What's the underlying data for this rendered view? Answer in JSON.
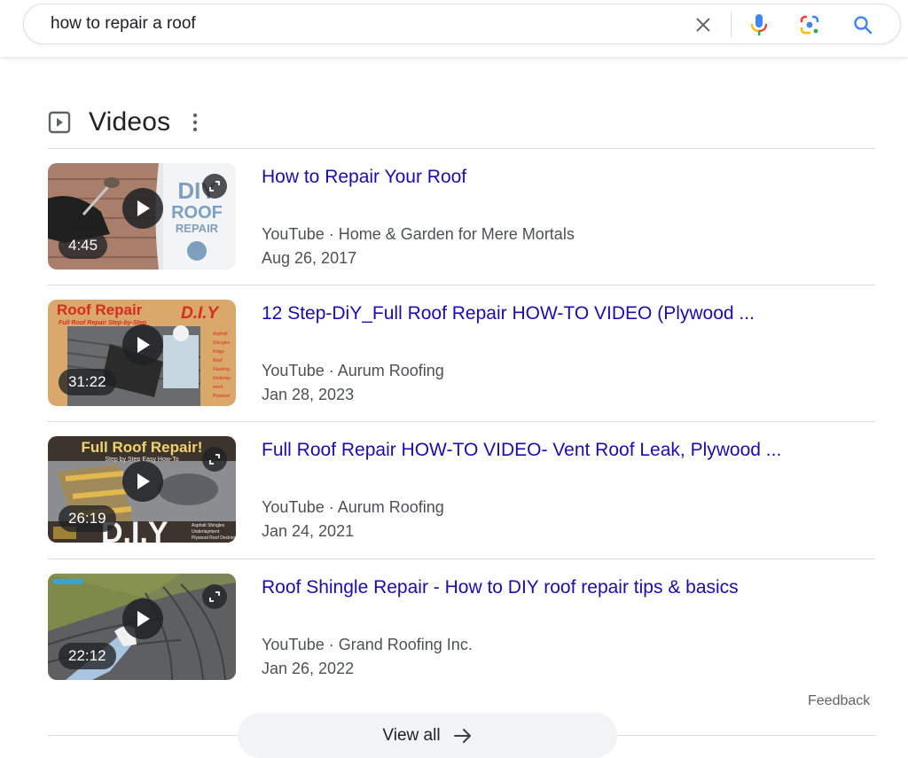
{
  "search": {
    "query": "how to repair a roof",
    "icons": {
      "clear": "close-icon",
      "voice": "microphone-icon",
      "image": "google-lens-icon",
      "submit": "search-icon"
    }
  },
  "videos": {
    "heading": "Videos",
    "heading_icon": "video-play-icon",
    "more_icon": "more-vert-icon",
    "items": [
      {
        "title": "How to Repair Your Roof",
        "source": "YouTube",
        "channel": "Home & Garden for Mere Mortals",
        "source_line": "YouTube · Home & Garden for Mere Mortals",
        "date": "Aug 26, 2017",
        "duration": "4:45",
        "thumb_text": [
          "DIY",
          "ROOF",
          "REPAIR"
        ],
        "has_expand": true
      },
      {
        "title": "12 Step-DiY_Full Roof Repair HOW-TO VIDEO (Plywood ...",
        "source": "YouTube",
        "channel": "Aurum Roofing",
        "source_line": "YouTube · Aurum Roofing",
        "date": "Jan 28, 2023",
        "duration": "31:22",
        "thumb_text": [
          "Roof Repair",
          "D.I.Y",
          "Full Roof Repair Step-by-Step"
        ],
        "has_expand": false
      },
      {
        "title": "Full Roof Repair HOW-TO VIDEO- Vent Roof Leak, Plywood ...",
        "source": "YouTube",
        "channel": "Aurum Roofing",
        "source_line": "YouTube · Aurum Roofing",
        "date": "Jan 24, 2021",
        "duration": "26:19",
        "thumb_text": [
          "Full Roof Repair!",
          "Step by Step Easy How-To",
          "D.I.Y"
        ],
        "has_expand": true
      },
      {
        "title": "Roof Shingle Repair - How to DIY roof repair tips & basics",
        "source": "YouTube",
        "channel": "Grand Roofing Inc.",
        "source_line": "YouTube · Grand Roofing Inc.",
        "date": "Jan 26, 2022",
        "duration": "22:12",
        "thumb_text": [],
        "has_expand": true
      }
    ]
  },
  "footer": {
    "feedback_label": "Feedback",
    "view_all_label": "View all",
    "view_all_icon": "arrow-right-icon"
  },
  "colors": {
    "link": "#1a0dab",
    "meta_text": "#4d5156",
    "divider": "#dadce0",
    "button_bg": "#f1f3f4"
  }
}
